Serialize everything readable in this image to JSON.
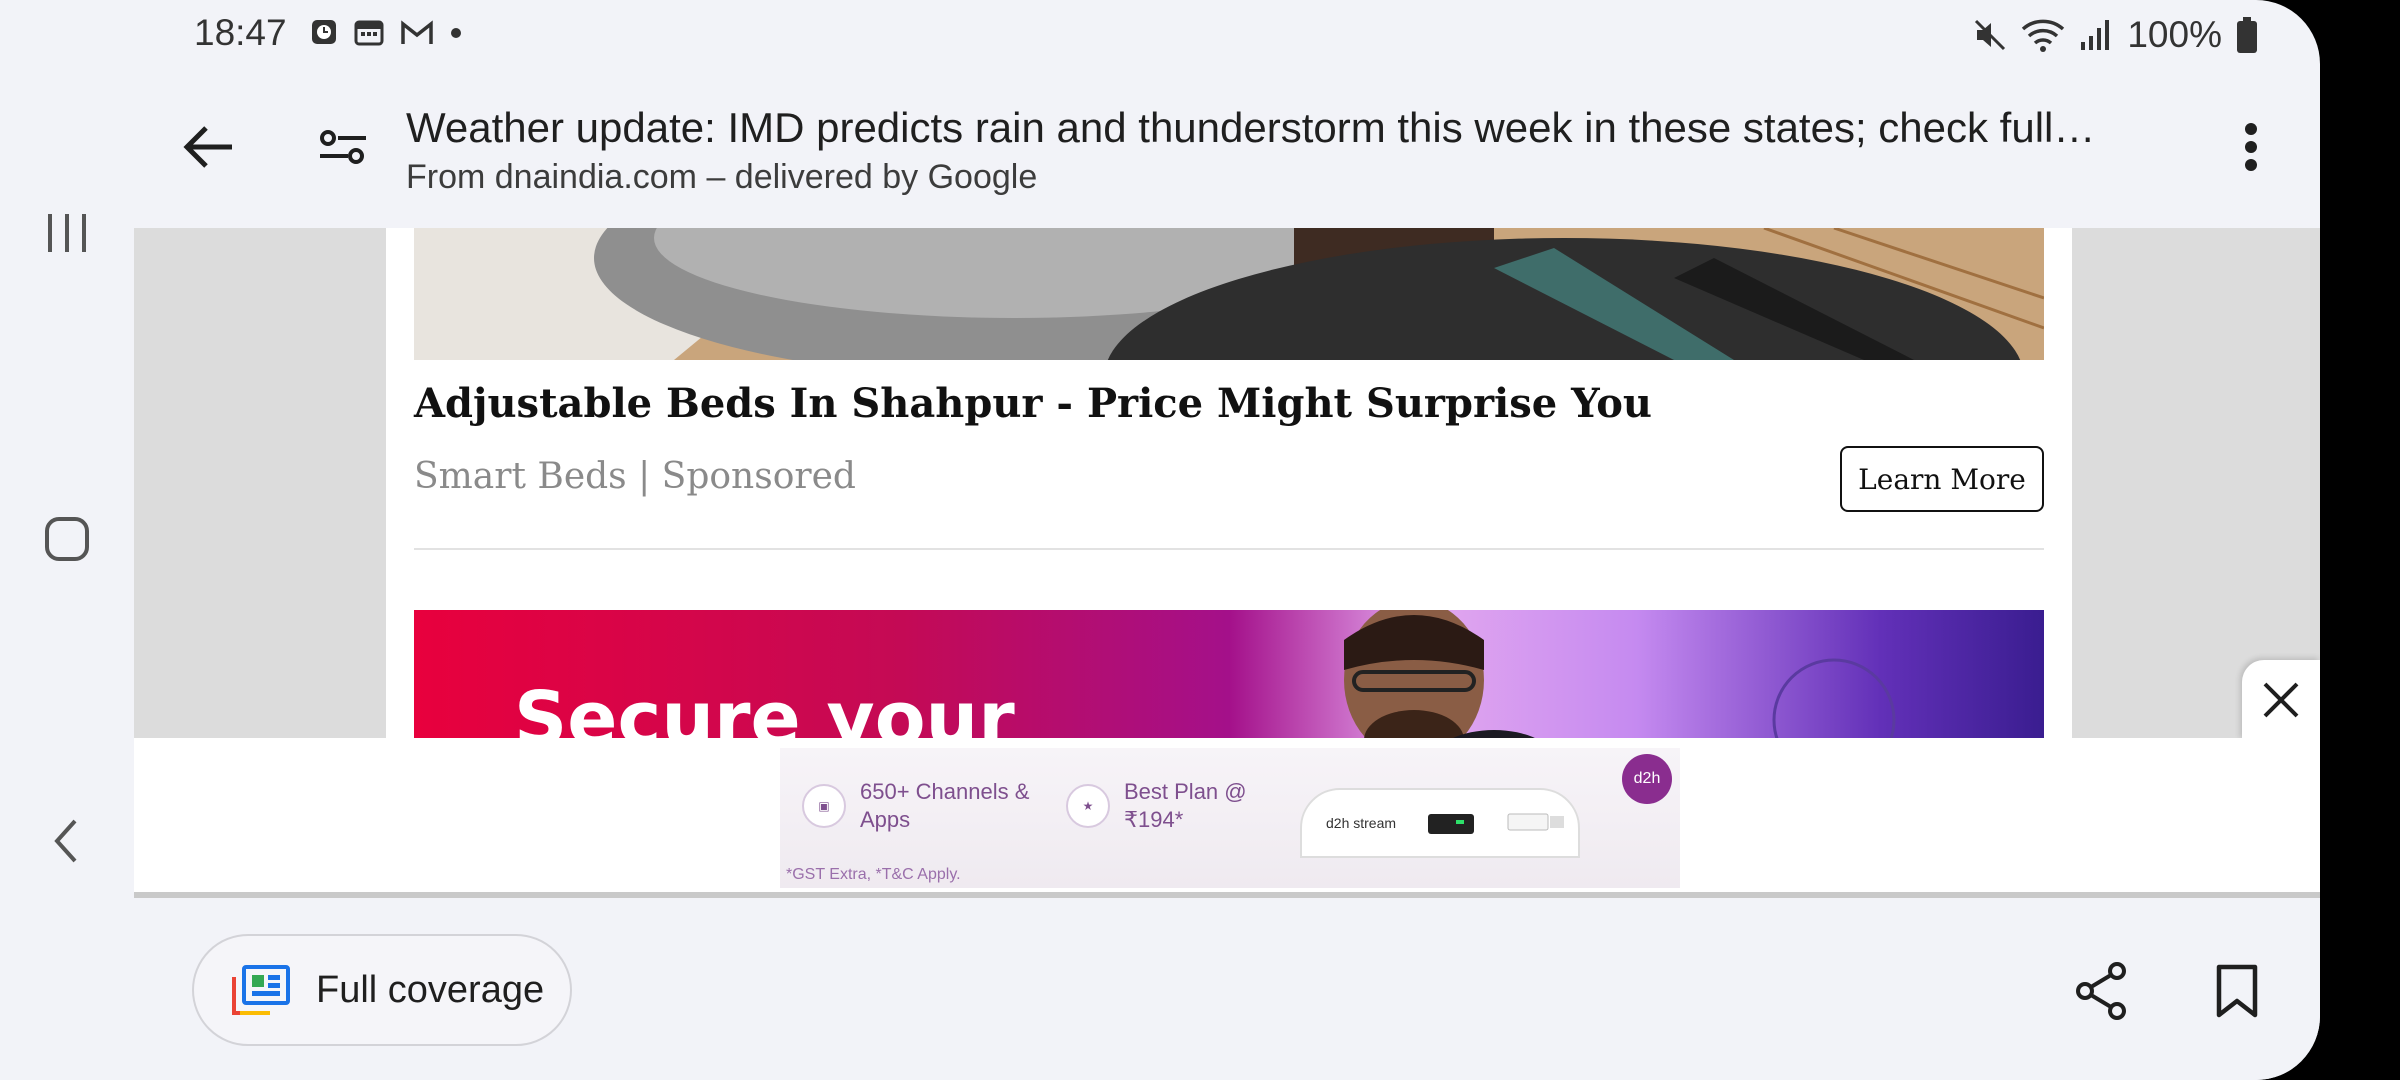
{
  "status_bar": {
    "time": "18:47",
    "battery": "100%",
    "left_icons": [
      "clock-icon",
      "calendar-icon",
      "gmail-icon",
      "dot-icon"
    ],
    "right_icons": [
      "mute-icon",
      "wifi-icon",
      "signal-icon",
      "battery-icon"
    ]
  },
  "app_bar": {
    "title": "Weather update: IMD predicts rain and thunderstorm this week in these states; check full…",
    "subtitle": "From dnaindia.com – delivered by Google"
  },
  "ad": {
    "title": "Adjustable Beds In Shahpur - Price Might Surprise You",
    "meta": "Smart Beds | Sponsored",
    "button": "Learn More"
  },
  "promo": {
    "text": "Secure your"
  },
  "d2h_ad": {
    "item1": "650+ Channels & Apps",
    "item2": "Best Plan @ ₹194*",
    "small": "*GST Extra, *T&C Apply.",
    "device_label": "d2h stream",
    "logo": "d2h"
  },
  "bottom_bar": {
    "coverage_label": "Full coverage"
  },
  "colors": {
    "background": "#f2f3f8",
    "text": "#1f1f1f"
  }
}
